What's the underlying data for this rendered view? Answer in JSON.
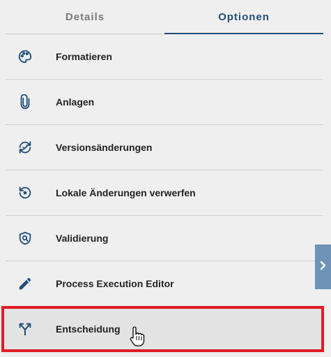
{
  "tabs": [
    {
      "label": "Details",
      "active": false
    },
    {
      "label": "Optionen",
      "active": true
    }
  ],
  "menu": {
    "items": [
      {
        "label": "Formatieren",
        "icon": "palette-icon"
      },
      {
        "label": "Anlagen",
        "icon": "paperclip-icon"
      },
      {
        "label": "Versionsänderungen",
        "icon": "sync-icon"
      },
      {
        "label": "Lokale Änderungen verwerfen",
        "icon": "restore-icon"
      },
      {
        "label": "Validierung",
        "icon": "shield-check-icon"
      },
      {
        "label": "Process Execution Editor",
        "icon": "pencil-icon"
      },
      {
        "label": "Entscheidung",
        "icon": "split-arrow-icon"
      }
    ],
    "highlighted_index": 6
  },
  "colors": {
    "accent": "#1f4e79",
    "icon": "#1f4e79",
    "highlight_border": "#e01b24",
    "expand_button": "#6f93b7"
  },
  "expand_button": {
    "icon": "chevron-right-icon"
  }
}
